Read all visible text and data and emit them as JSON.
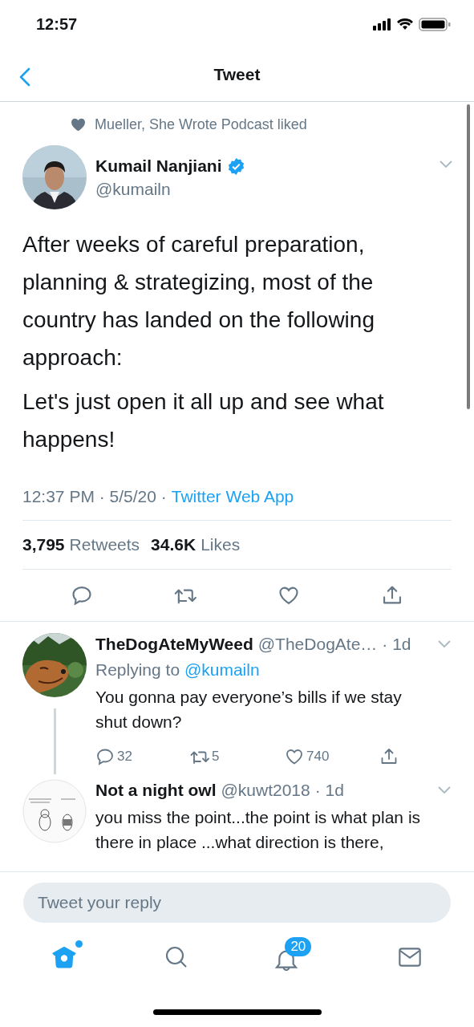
{
  "status_bar": {
    "time": "12:57"
  },
  "nav": {
    "title": "Tweet"
  },
  "tweet": {
    "social_context": "Mueller, She Wrote Podcast liked",
    "author": {
      "name": "Kumail Nanjiani",
      "handle": "@kumailn",
      "verified": true
    },
    "paragraphs": [
      "After weeks of careful preparation, planning & strategizing, most of the country has landed on the following approach:",
      "Let's just open it all up and see what happens!"
    ],
    "timestamp": "12:37 PM · 5/5/20 ·",
    "source": "Twitter Web App",
    "stats": [
      {
        "count": "3,795",
        "label": "Retweets"
      },
      {
        "count": "34.6K",
        "label": "Likes"
      }
    ]
  },
  "replies": [
    {
      "name": "TheDogAteMyWeed",
      "handle": "@TheDogAte…",
      "time": "· 1d",
      "replying_to_label": "Replying to",
      "replying_to": "@kumailn",
      "text": "You gonna pay everyone’s bills if we stay shut down?",
      "counts": {
        "reply": "32",
        "retweet": "5",
        "like": "740"
      }
    },
    {
      "name": "Not a night owl",
      "handle": "@kuwt2018",
      "time": "· 1d",
      "text": "you miss the point...the point is what plan is there in place ...what direction is there,"
    }
  ],
  "compose": {
    "placeholder": "Tweet your reply"
  },
  "tabs": [
    {
      "kind": "home",
      "selected": true,
      "dot": true
    },
    {
      "kind": "search",
      "selected": false,
      "dot": false
    },
    {
      "kind": "notifications",
      "selected": false,
      "dot": false,
      "badge": "20"
    },
    {
      "kind": "messages",
      "selected": false,
      "dot": false
    }
  ]
}
